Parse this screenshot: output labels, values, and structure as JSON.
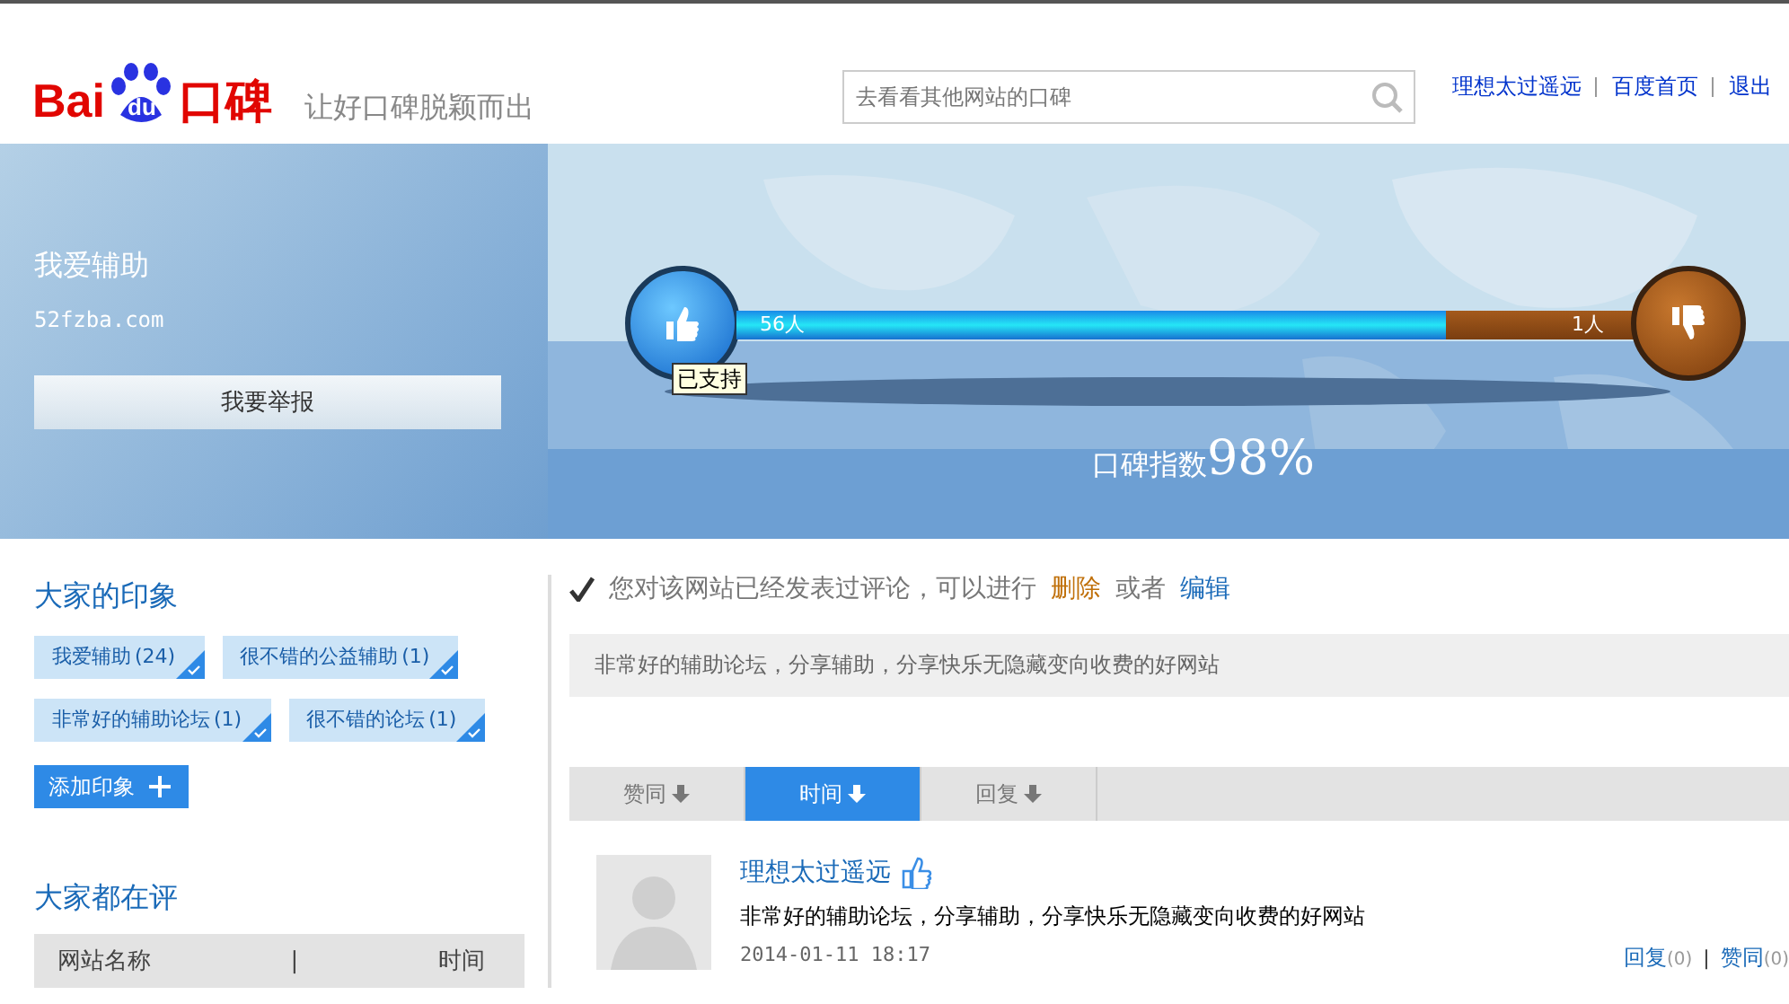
{
  "header": {
    "logo": {
      "left": "Bai",
      "badge": "du",
      "right": "口碑"
    },
    "slogan": "让好口碑脱颖而出",
    "search": {
      "placeholder": "去看看其他网站的口碑"
    },
    "links": [
      "理想太过遥远",
      "百度首页",
      "退出"
    ]
  },
  "site": {
    "name": "我爱辅助",
    "domain": "52fzba.com",
    "report_button": "我要举报"
  },
  "meter": {
    "up_count": "56人",
    "down_count": "1人",
    "level": 0.76,
    "up_tooltip": "已支持",
    "index_label": "口碑指数",
    "index_value": "98%"
  },
  "impressions": {
    "title": "大家的印象",
    "tags": [
      {
        "label": "我爱辅助",
        "count": "(24)"
      },
      {
        "label": "很不错的公益辅助",
        "count": "(1)"
      },
      {
        "label": "非常好的辅助论坛",
        "count": "(1)"
      },
      {
        "label": "很不错的论坛",
        "count": "(1)"
      }
    ],
    "add_button": "添加印象"
  },
  "reviewing": {
    "title": "大家都在评",
    "columns": [
      "网站名称",
      "|",
      "时间"
    ]
  },
  "status": {
    "text": "您对该网站已经发表过评论，可以进行",
    "delete": "删除",
    "or": "或者",
    "edit": "编辑"
  },
  "my_review": "非常好的辅助论坛，分享辅助，分享快乐无隐藏变向收费的好网站",
  "sort_tabs": [
    {
      "label": "赞同",
      "selected": false
    },
    {
      "label": "时间",
      "selected": true
    },
    {
      "label": "回复",
      "selected": false
    }
  ],
  "comments": [
    {
      "user": "理想太过遥远",
      "text": "非常好的辅助论坛，分享辅助，分享快乐无隐藏变向收费的好网站",
      "time": "2014-01-11 18:17",
      "reply": "回复",
      "reply_count": "(0)",
      "sep": "|",
      "agree": "赞同",
      "agree_count": "(0)"
    }
  ]
}
